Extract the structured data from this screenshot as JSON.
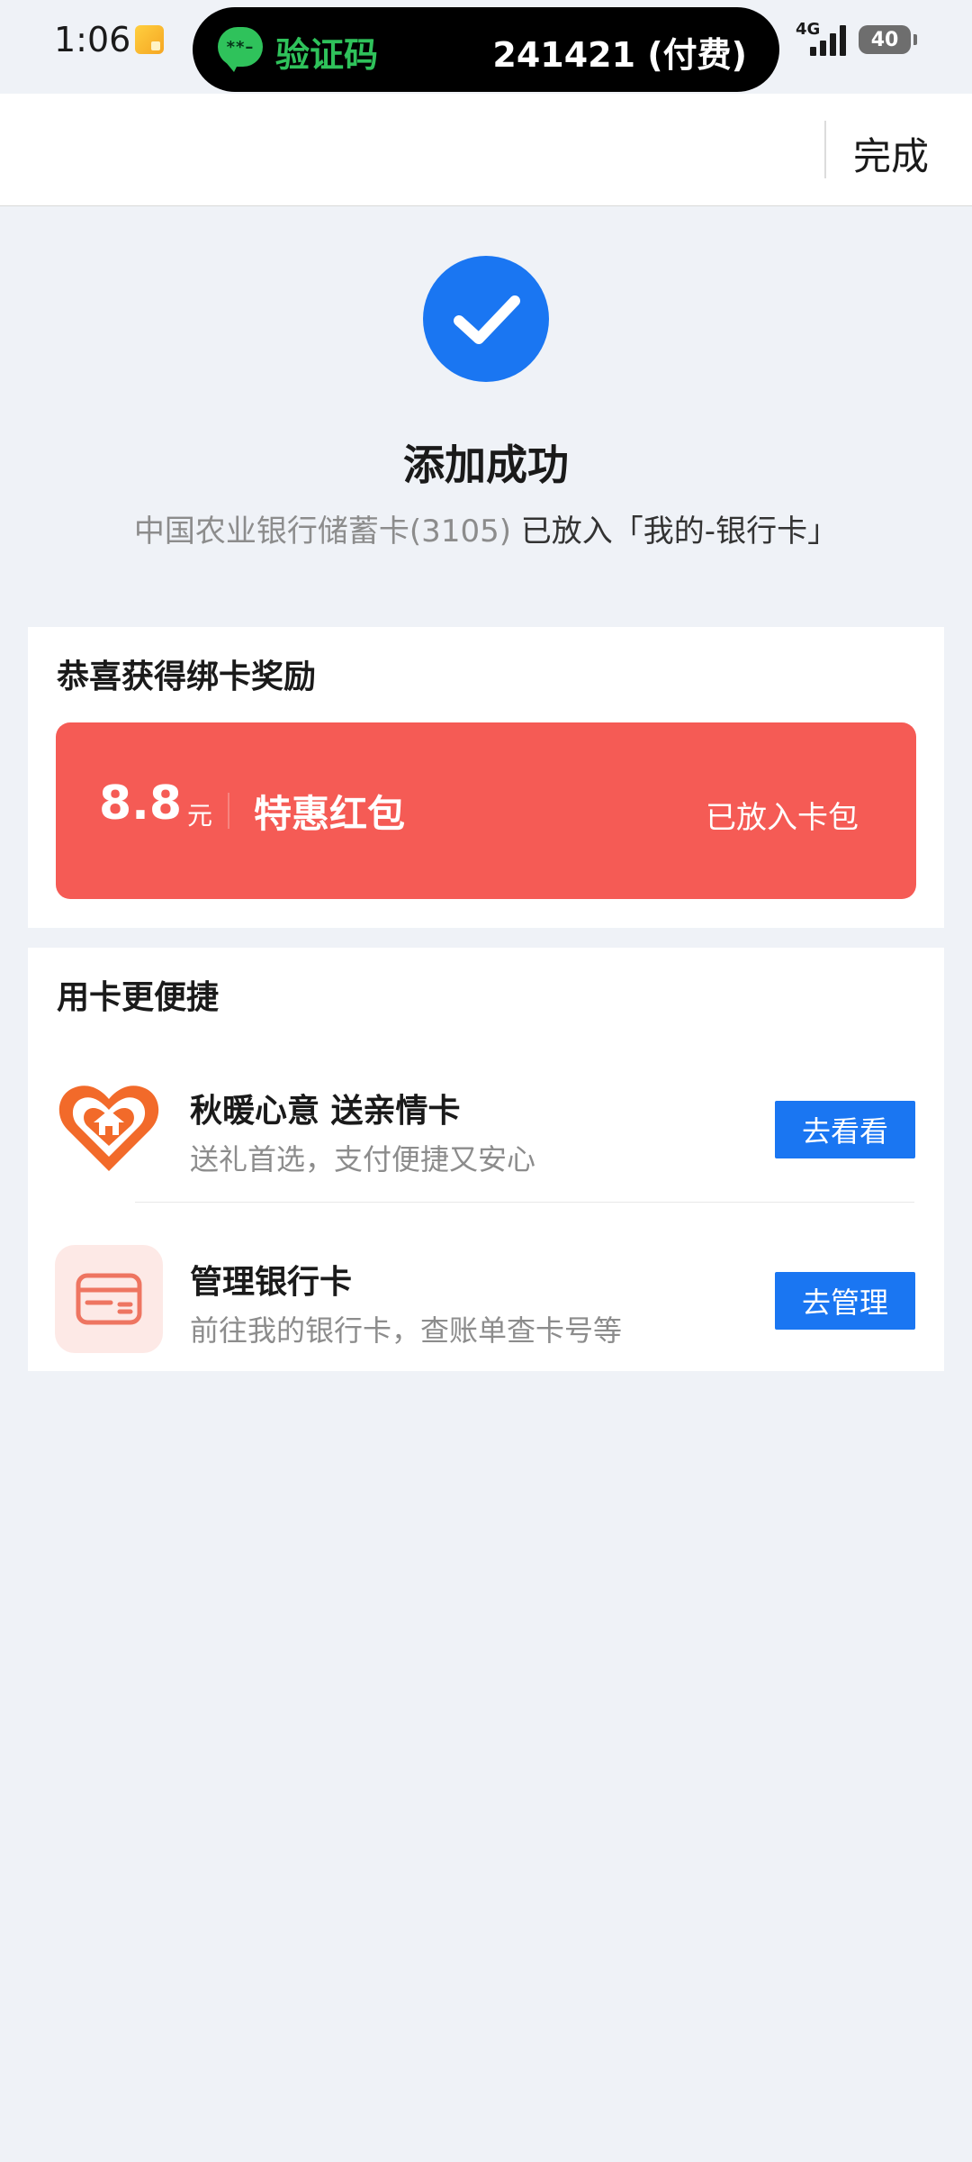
{
  "status_bar": {
    "time": "1:06",
    "sms_title": "验证码",
    "sms_code": "241421 (付费)",
    "network": "4G",
    "battery": "40"
  },
  "header": {
    "done_label": "完成"
  },
  "success": {
    "title": "添加成功",
    "card_name": "中国农业银行储蓄卡(3105)",
    "destination": "已放入「我的-银行卡」"
  },
  "reward": {
    "section_title": "恭喜获得绑卡奖励",
    "amount": "8.8",
    "unit": "元",
    "name": "特惠红包",
    "status": "已放入卡包"
  },
  "quick": {
    "section_title": "用卡更便捷",
    "items": [
      {
        "title": "秋暖心意 送亲情卡",
        "desc": "送礼首选，支付便捷又安心",
        "button": "去看看",
        "icon": "heart-house-icon"
      },
      {
        "title": "管理银行卡",
        "desc": "前往我的银行卡，查账单查卡号等",
        "button": "去管理",
        "icon": "bank-card-icon"
      }
    ]
  },
  "colors": {
    "accent": "#1a76f2",
    "coupon": "#f55b55",
    "background": "#eff2f7"
  }
}
